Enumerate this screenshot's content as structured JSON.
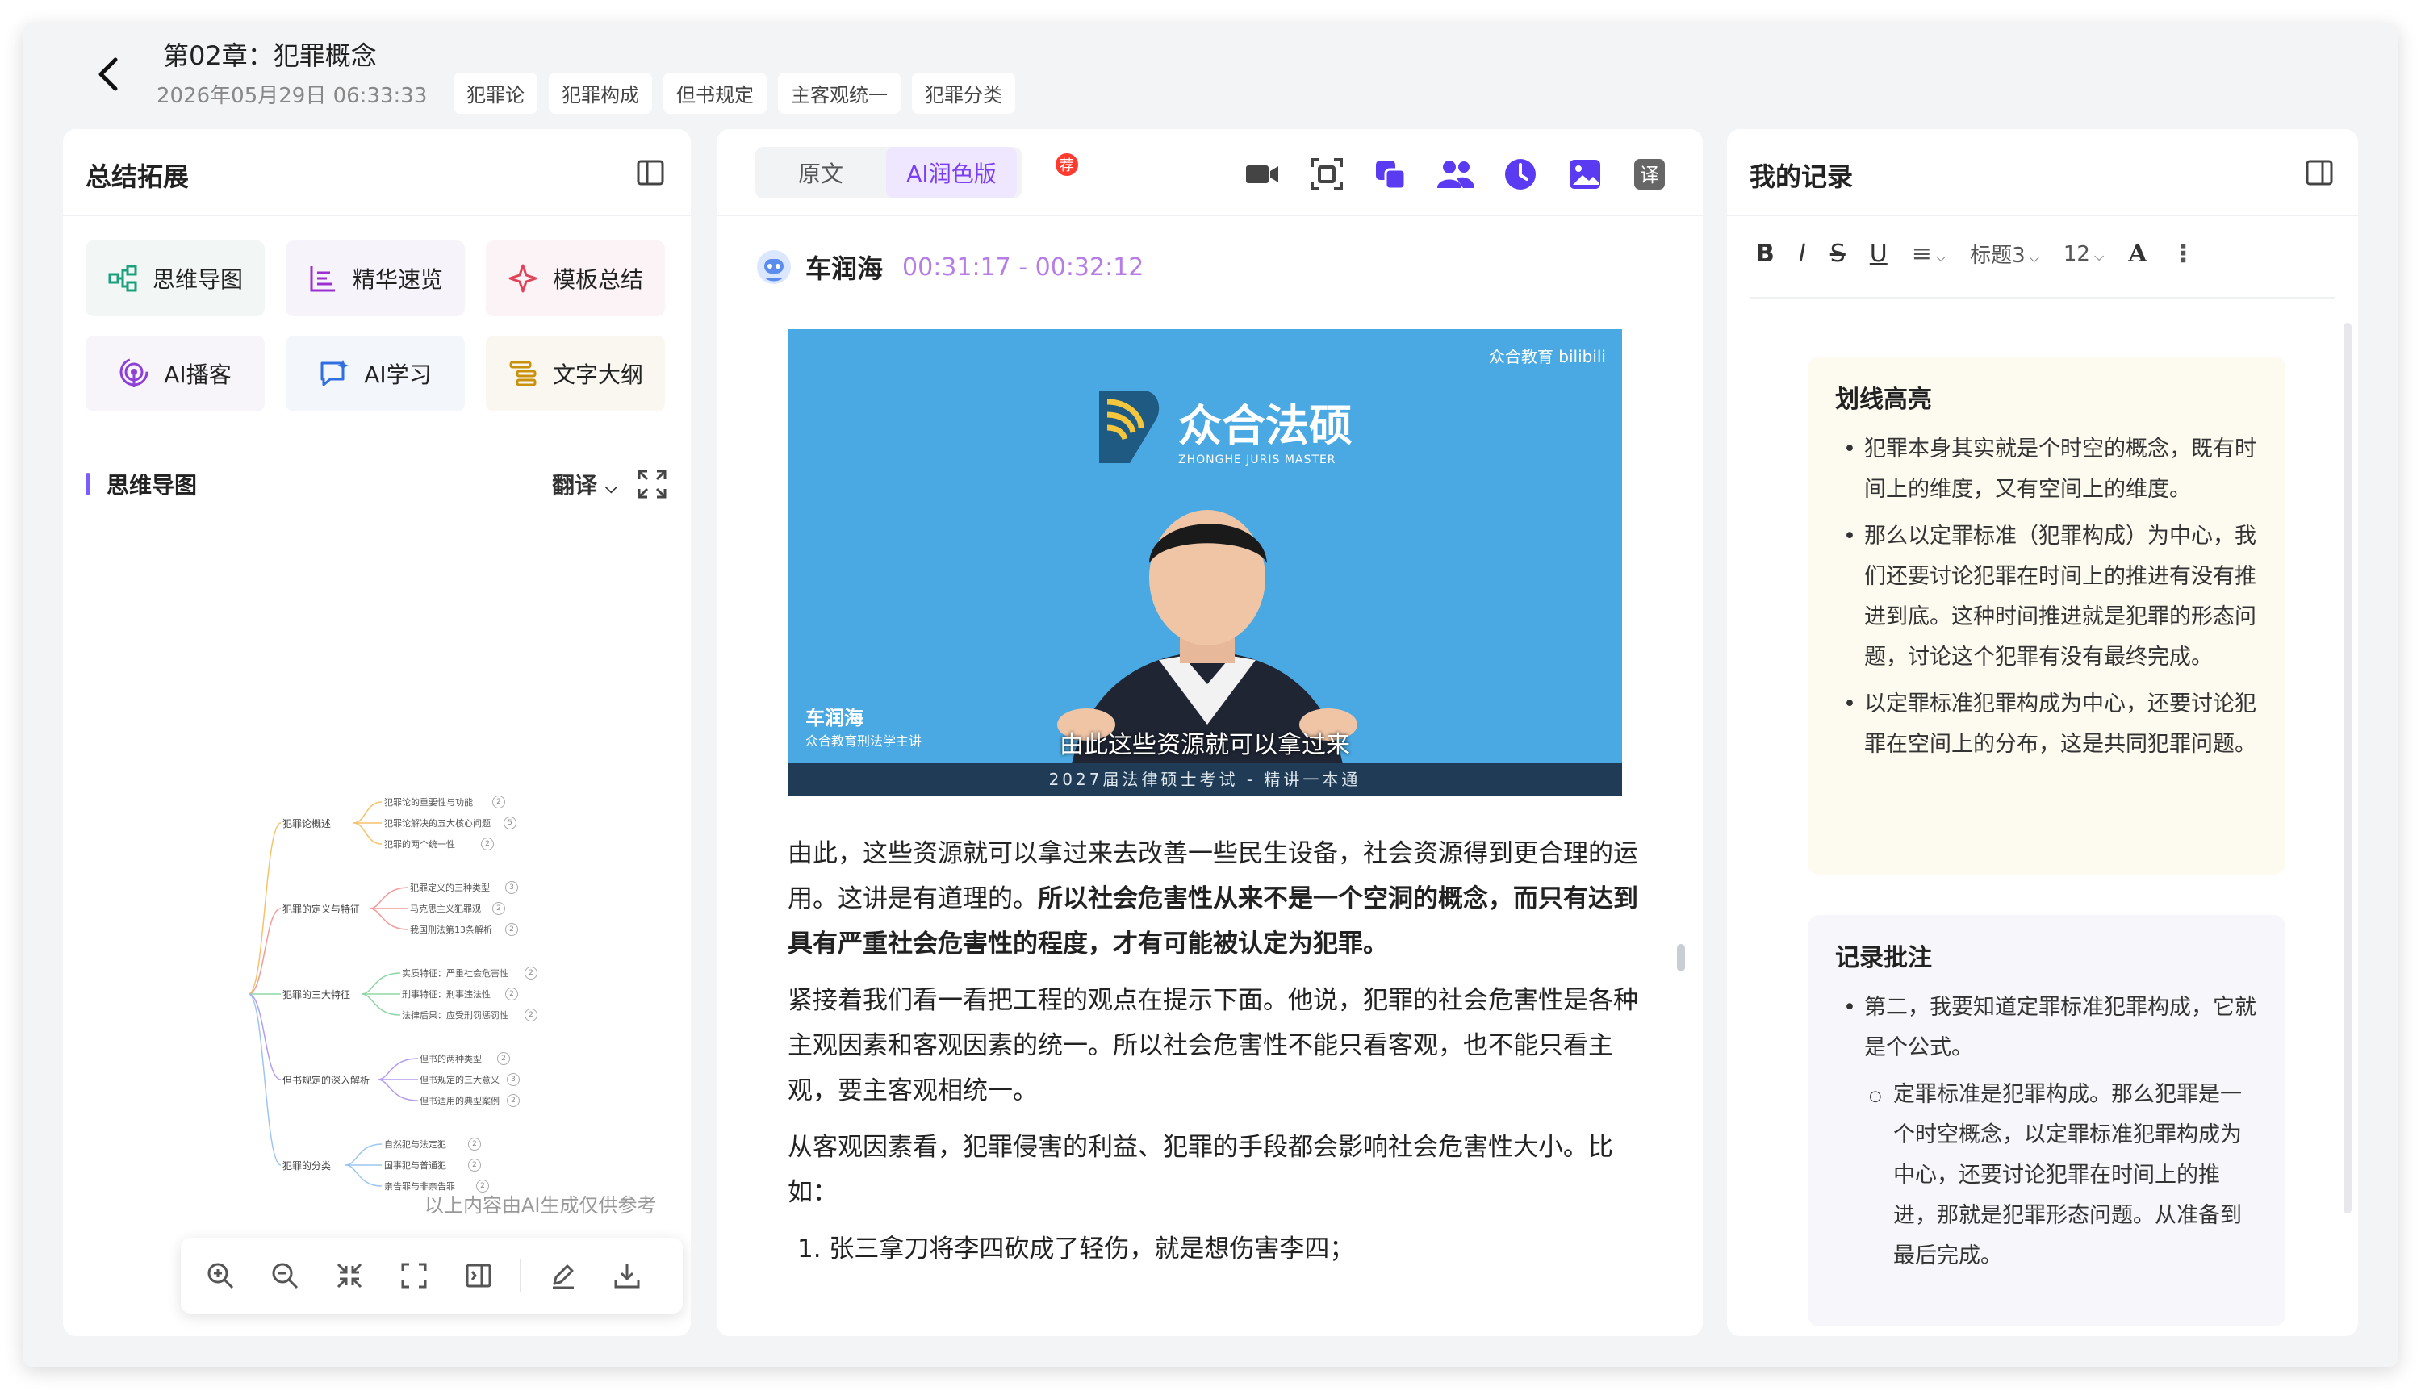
{
  "header": {
    "title": "第02章：犯罪概念",
    "datetime": "2026年05月29日 06:33:33",
    "tags": [
      "犯罪论",
      "犯罪构成",
      "但书规定",
      "主客观统一",
      "犯罪分类"
    ]
  },
  "left_panel": {
    "title": "总结拓展",
    "tools": [
      {
        "label": "思维导图",
        "icon": "mindmap-icon",
        "color": "#1aa07a"
      },
      {
        "label": "精华速览",
        "icon": "summary-list-icon",
        "color": "#9b2fd0"
      },
      {
        "label": "模板总结",
        "icon": "sparkle-icon",
        "color": "#e0445a"
      },
      {
        "label": "AI播客",
        "icon": "podcast-icon",
        "color": "#8e3fd6"
      },
      {
        "label": "AI学习",
        "icon": "chat-sparkle-icon",
        "color": "#2f6fe0"
      },
      {
        "label": "文字大纲",
        "icon": "outline-icon",
        "color": "#c9920c"
      }
    ],
    "mindmap": {
      "title": "思维导图",
      "translate_label": "翻译",
      "note": "以上内容由AI生成仅供参考",
      "branches": [
        {
          "label": "犯罪论概述",
          "color": "#f5c26b",
          "children": [
            "犯罪论的重要性与功能",
            "犯罪论解决的五大核心问题",
            "犯罪的两个统一性"
          ],
          "nums": [
            "2",
            "5",
            "2"
          ]
        },
        {
          "label": "犯罪的定义与特征",
          "color": "#f29b9b",
          "children": [
            "犯罪定义的三种类型",
            "马克思主义犯罪观",
            "我国刑法第13条解析"
          ],
          "nums": [
            "3",
            "2",
            "2"
          ]
        },
        {
          "label": "犯罪的三大特征",
          "color": "#8fd6a6",
          "children": [
            "实质特征：严重社会危害性",
            "刑事特征：刑事违法性",
            "法律后果：应受刑罚惩罚性"
          ],
          "nums": [
            "2",
            "2",
            "2"
          ]
        },
        {
          "label": "但书规定的深入解析",
          "color": "#b49cf0",
          "children": [
            "但书的两种类型",
            "但书规定的三大意义",
            "但书适用的典型案例"
          ],
          "nums": [
            "2",
            "3",
            "2"
          ]
        },
        {
          "label": "犯罪的分类",
          "color": "#9cc6f0",
          "children": [
            "自然犯与法定犯",
            "国事犯与普通犯",
            "亲告罪与非亲告罪"
          ],
          "nums": [
            "2",
            "2",
            "2"
          ]
        }
      ]
    }
  },
  "middle_panel": {
    "tab_original": "原文",
    "tab_ai": "AI润色版",
    "badge": "荐",
    "toolbar_icons": [
      "video-camera-icon",
      "screenshot-icon",
      "copy-icon",
      "people-icon",
      "clock-icon",
      "image-icon",
      "translate-icon"
    ],
    "speaker": {
      "name": "车润海",
      "time": "00:31:17 - 00:32:12"
    },
    "video": {
      "watermark": "众合教育 bilibili",
      "brand": "众合法硕",
      "brand_sub": "ZHONGHE JURIS MASTER",
      "lower_name": "车润海",
      "lower_title": "众合教育刑法学主讲",
      "subtitle": "由此这些资源就可以拿过来",
      "footer": "2027届法律硕士考试 - 精讲一本通"
    },
    "paragraphs": [
      {
        "normal": "由此，这些资源就可以拿过来去改善一些民生设备，社会资源得到更合理的运用。这讲是有道理的。",
        "bold": "所以社会危害性从来不是一个空洞的概念，而只有达到具有严重社会危害性的程度，才有可能被认定为犯罪。"
      },
      {
        "normal": "紧接着我们看一看把工程的观点在提示下面。他说，犯罪的社会危害性是各种主观因素和客观因素的统一。所以社会危害性不能只看客观，也不能只看主观，要主客观相统一。",
        "bold": ""
      },
      {
        "normal": "从客观因素看，犯罪侵害的利益、犯罪的手段都会影响社会危害性大小。比如：",
        "bold": ""
      }
    ],
    "list_item": "1. 张三拿刀将李四砍成了轻伤，就是想伤害李四；"
  },
  "right_panel": {
    "title": "我的记录",
    "toolbar": {
      "bold": "B",
      "italic": "I",
      "strike": "S",
      "underline": "U",
      "align": "≡",
      "heading": "标题3",
      "size": "12",
      "font": "A",
      "more": "⋮"
    },
    "highlight_card": {
      "title": "划线高亮",
      "items": [
        "犯罪本身其实就是个时空的概念，既有时间上的维度，又有空间上的维度。",
        "那么以定罪标准（犯罪构成）为中心，我们还要讨论犯罪在时间上的推进有没有推进到底。这种时间推进就是犯罪的形态问题，讨论这个犯罪有没有最终完成。",
        "以定罪标准犯罪构成为中心，还要讨论犯罪在空间上的分布，这是共同犯罪问题。"
      ]
    },
    "note_card": {
      "title": "记录批注",
      "item": "第二，我要知道定罪标准犯罪构成，它就是个公式。",
      "sub_item": "定罪标准是犯罪构成。那么犯罪是一个时空概念，以定罪标准犯罪构成为中心，还要讨论犯罪在时间上的推进，那就是犯罪形态问题。从准备到最后完成。"
    }
  }
}
